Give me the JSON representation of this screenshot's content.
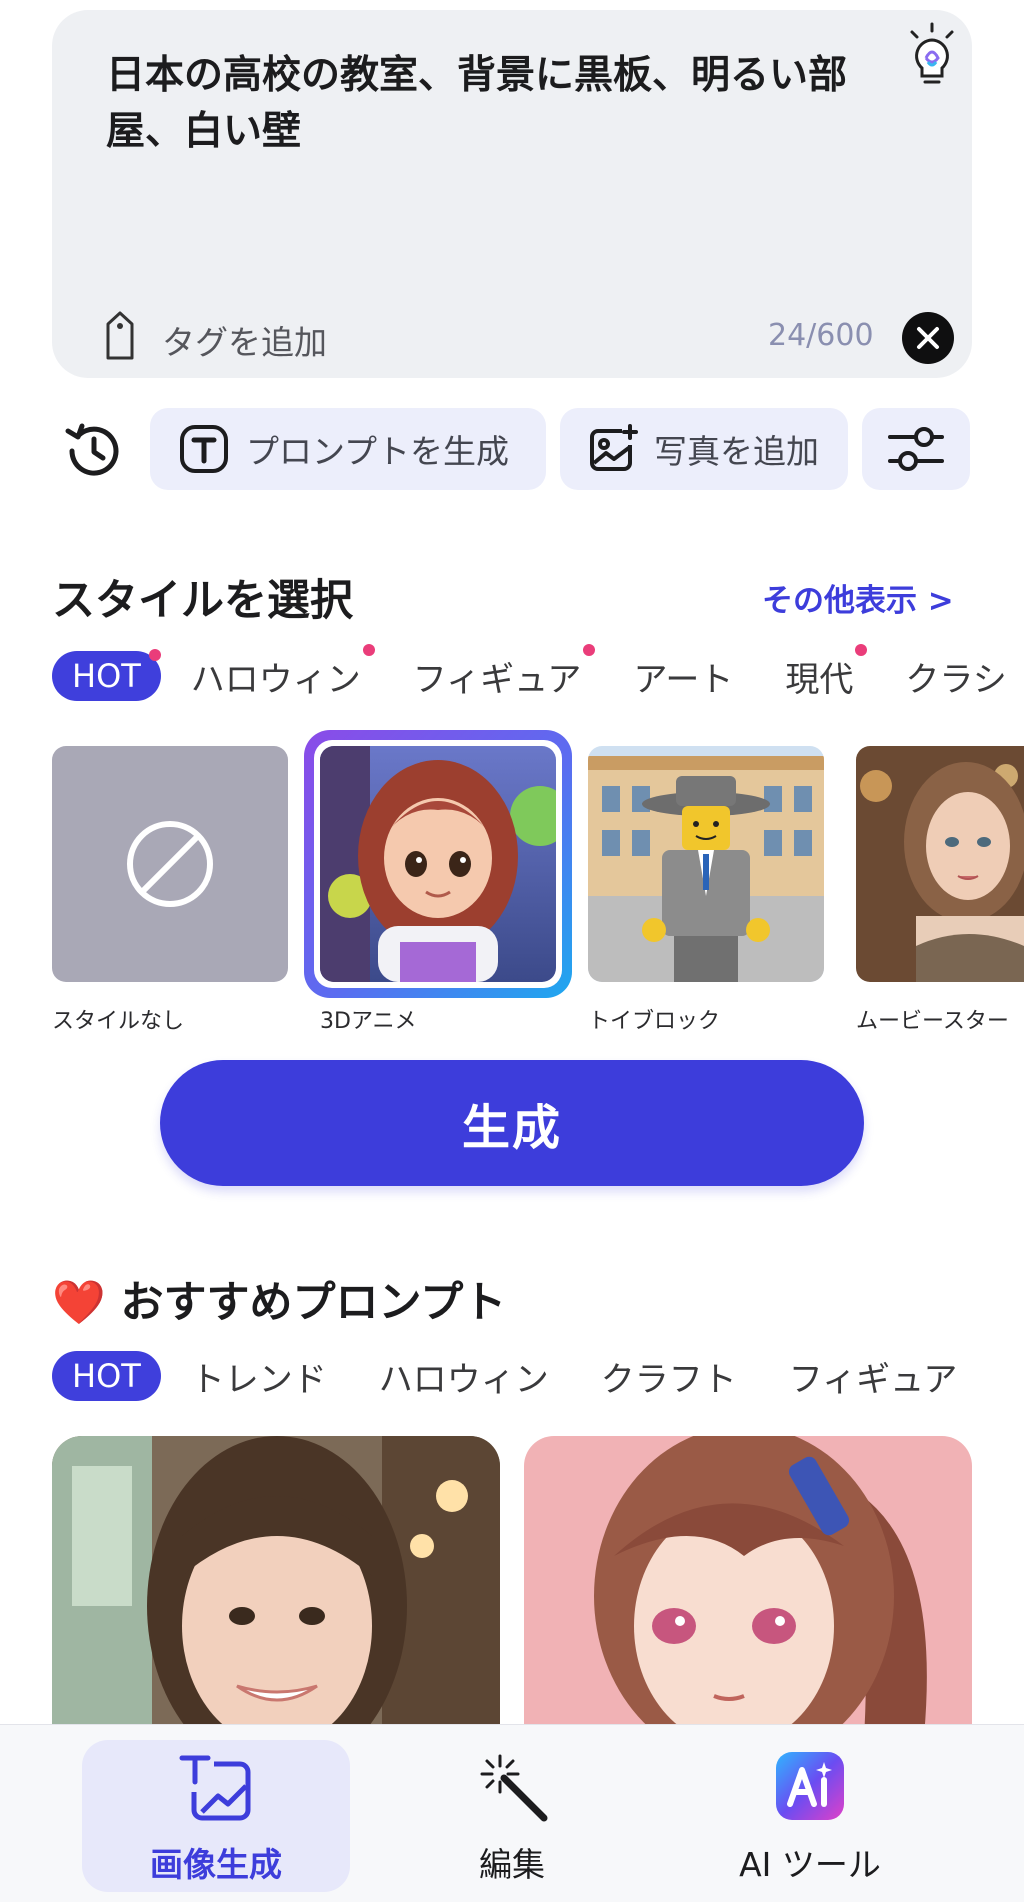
{
  "prompt": {
    "text": "日本の高校の教室、背景に黒板、明るい部屋、白い壁",
    "tag_label": "タグを追加",
    "counter": "24/600"
  },
  "toolbar": {
    "generate_prompt_label": "プロンプトを生成",
    "add_photo_label": "写真を追加"
  },
  "style_section": {
    "title": "スタイルを選択",
    "more_label": "その他表示 >",
    "tabs": [
      {
        "label": "HOT",
        "dot": true
      },
      {
        "label": "ハロウィン",
        "dot": true
      },
      {
        "label": "フィギュア",
        "dot": true
      },
      {
        "label": "アート",
        "dot": false
      },
      {
        "label": "現代",
        "dot": true
      },
      {
        "label": "クラシ",
        "dot": false
      }
    ],
    "cards": [
      {
        "label": "スタイルなし"
      },
      {
        "label": "3Dアニメ",
        "selected": true
      },
      {
        "label": "トイブロック"
      },
      {
        "label": "ムービースター"
      }
    ]
  },
  "generate_button": {
    "label": "生成"
  },
  "recommended": {
    "emoji": "❤️",
    "title": "おすすめプロンプト",
    "tabs": [
      "HOT",
      "トレンド",
      "ハロウィン",
      "クラフト",
      "フィギュア"
    ]
  },
  "bottom_nav": {
    "items": [
      {
        "label": "画像生成",
        "icon": "image-generate-icon",
        "active": true
      },
      {
        "label": "編集",
        "icon": "magic-wand-icon",
        "active": false
      },
      {
        "label": "AI ツール",
        "icon": "ai-tools-icon",
        "active": false
      }
    ]
  },
  "colors": {
    "accent": "#3d3ddb",
    "tab_dot": "#ea3d7a",
    "prompt_bg": "#eef0f3",
    "chip_bg": "#eceefb"
  }
}
